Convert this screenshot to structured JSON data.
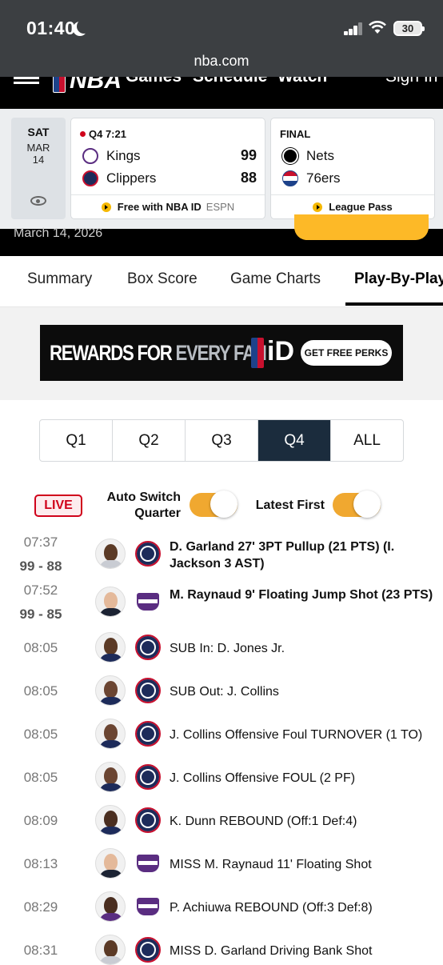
{
  "status_bar": {
    "time": "01:40",
    "battery": "30",
    "url": "nba.com"
  },
  "header": {
    "logo_text": "NBA",
    "nav": [
      "Games",
      "Schedule",
      "Watch"
    ],
    "sign_in": "Sign In"
  },
  "scoreboard": {
    "date": {
      "day": "SAT",
      "month": "MAR",
      "date": "14"
    },
    "games": [
      {
        "status": "Q4 7:21",
        "live": true,
        "teams": [
          {
            "name": "Kings",
            "score": "99"
          },
          {
            "name": "Clippers",
            "score": "88"
          }
        ],
        "footer": "Free with NBA ID",
        "network": "ESPN"
      },
      {
        "status": "FINAL",
        "live": false,
        "teams": [
          {
            "name": "Nets",
            "score": ""
          },
          {
            "name": "76ers",
            "score": ""
          }
        ],
        "footer": "League Pass",
        "network": ""
      }
    ]
  },
  "game_date": "March 14, 2026",
  "tabs": [
    "Summary",
    "Box Score",
    "Game Charts",
    "Play-By-Play"
  ],
  "active_tab": "Play-By-Play",
  "ad": {
    "text_a": "REWARDS FOR ",
    "text_b": "EVERY FAN",
    "brand_id": "iD",
    "button": "GET FREE PERKS"
  },
  "quarters": [
    "Q1",
    "Q2",
    "Q3",
    "Q4",
    "ALL"
  ],
  "active_quarter": "Q4",
  "controls": {
    "live_badge": "LIVE",
    "auto_switch_line1": "Auto Switch",
    "auto_switch_line2": "Quarter",
    "latest_first": "Latest First",
    "auto_switch_on": true,
    "latest_first_on": true
  },
  "plays": [
    {
      "time": "07:37",
      "score": "99 - 88",
      "team": "clippers",
      "text": "D. Garland 27' 3PT Pullup (21 PTS) (I. Jackson 3 AST)",
      "scoring": true
    },
    {
      "time": "07:52",
      "score": "99 - 85",
      "team": "kings",
      "text": "M. Raynaud 9' Floating Jump Shot (23 PTS)",
      "scoring": true
    },
    {
      "time": "08:05",
      "score": "",
      "team": "clippers",
      "text": "SUB In: D. Jones Jr.",
      "scoring": false
    },
    {
      "time": "08:05",
      "score": "",
      "team": "clippers",
      "text": "SUB Out: J. Collins",
      "scoring": false
    },
    {
      "time": "08:05",
      "score": "",
      "team": "clippers",
      "text": "J. Collins Offensive Foul TURNOVER (1 TO)",
      "scoring": false
    },
    {
      "time": "08:05",
      "score": "",
      "team": "clippers",
      "text": "J. Collins Offensive FOUL (2 PF)",
      "scoring": false
    },
    {
      "time": "08:09",
      "score": "",
      "team": "clippers",
      "text": "K. Dunn REBOUND (Off:1 Def:4)",
      "scoring": false
    },
    {
      "time": "08:13",
      "score": "",
      "team": "kings",
      "text": "MISS M. Raynaud 11' Floating Shot",
      "scoring": false
    },
    {
      "time": "08:29",
      "score": "",
      "team": "kings",
      "text": "P. Achiuwa REBOUND (Off:3 Def:8)",
      "scoring": false
    },
    {
      "time": "08:31",
      "score": "",
      "team": "clippers",
      "text": "MISS D. Garland Driving Bank Shot",
      "scoring": false
    }
  ]
}
